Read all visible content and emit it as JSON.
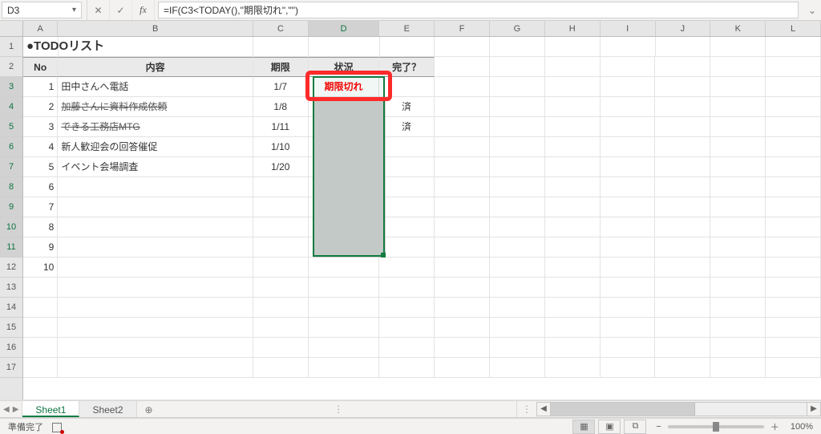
{
  "formula_bar": {
    "cell_ref": "D3",
    "cancel_symbol": "✕",
    "confirm_symbol": "✓",
    "fx_label": "fx",
    "formula": "=IF(C3<TODAY(),\"期限切れ\",\"\")",
    "expand_symbol": "⌄"
  },
  "columns": [
    "A",
    "B",
    "C",
    "D",
    "E",
    "F",
    "G",
    "H",
    "I",
    "J",
    "K",
    "L"
  ],
  "row_numbers": [
    1,
    2,
    3,
    4,
    5,
    6,
    7,
    8,
    9,
    10,
    11,
    12,
    13,
    14,
    15,
    16,
    17
  ],
  "sheet": {
    "title": "●TODOリスト",
    "header": {
      "no": "No",
      "content": "内容",
      "deadline": "期限",
      "status": "状況",
      "done": "完了？"
    },
    "rows": [
      {
        "no": 1,
        "content": "田中さんへ電話",
        "deadline": "1/7",
        "status": "期限切れ",
        "done": "",
        "strike": false
      },
      {
        "no": 2,
        "content": "加藤さんに資料作成依頼",
        "deadline": "1/8",
        "status": "",
        "done": "済",
        "strike": true
      },
      {
        "no": 3,
        "content": "できる工務店MTG",
        "deadline": "1/11",
        "status": "",
        "done": "済",
        "strike": true
      },
      {
        "no": 4,
        "content": "新人歓迎会の回答催促",
        "deadline": "1/10",
        "status": "",
        "done": "",
        "strike": false
      },
      {
        "no": 5,
        "content": "イベント会場調査",
        "deadline": "1/20",
        "status": "",
        "done": "",
        "strike": false
      },
      {
        "no": 6,
        "content": "",
        "deadline": "",
        "status": "",
        "done": "",
        "strike": false
      },
      {
        "no": 7,
        "content": "",
        "deadline": "",
        "status": "",
        "done": "",
        "strike": false
      },
      {
        "no": 8,
        "content": "",
        "deadline": "",
        "status": "",
        "done": "",
        "strike": false
      },
      {
        "no": 9,
        "content": "",
        "deadline": "",
        "status": "",
        "done": "",
        "strike": false
      },
      {
        "no": 10,
        "content": "",
        "deadline": "",
        "status": "",
        "done": "",
        "strike": false
      }
    ]
  },
  "tabs": {
    "sheet1": "Sheet1",
    "sheet2": "Sheet2",
    "add": "⊕",
    "nav_prev": "◀",
    "nav_next": "▶",
    "divider": "⋮",
    "scroll_divider": "⋮",
    "scroll_left": "◀",
    "scroll_right": "▶"
  },
  "statusbar": {
    "mode": "準備完了",
    "view_normal": "▦",
    "view_layout": "▣",
    "view_break": "⧉",
    "zoom_minus": "−",
    "zoom_plus": "＋",
    "zoom_value": "100%"
  },
  "selection": {
    "col": "D",
    "rows_from": 3,
    "rows_to": 11
  }
}
